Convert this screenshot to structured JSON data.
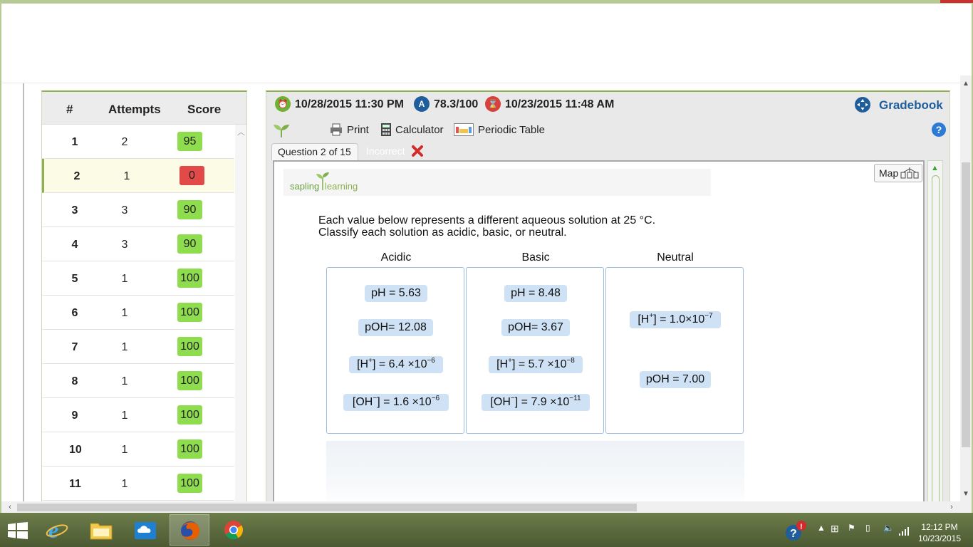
{
  "status": {
    "due_date": "10/28/2015 11:30 PM",
    "grade": "78.3/100",
    "last_date": "10/23/2015 11:48 AM",
    "gradebook_label": "Gradebook"
  },
  "toolbar": {
    "print_label": "Print",
    "calculator_label": "Calculator",
    "periodic_table_label": "Periodic Table"
  },
  "tabs": {
    "question_label": "Question 2 of 15",
    "status_label": "Incorrect"
  },
  "score_table": {
    "headers": [
      "#",
      "Attempts",
      "Score"
    ],
    "rows": [
      {
        "num": "1",
        "attempts": "2",
        "score": "95",
        "status": "green"
      },
      {
        "num": "2",
        "attempts": "1",
        "score": "0",
        "status": "red"
      },
      {
        "num": "3",
        "attempts": "3",
        "score": "90",
        "status": "green"
      },
      {
        "num": "4",
        "attempts": "3",
        "score": "90",
        "status": "green"
      },
      {
        "num": "5",
        "attempts": "1",
        "score": "100",
        "status": "green"
      },
      {
        "num": "6",
        "attempts": "1",
        "score": "100",
        "status": "green"
      },
      {
        "num": "7",
        "attempts": "1",
        "score": "100",
        "status": "green"
      },
      {
        "num": "8",
        "attempts": "1",
        "score": "100",
        "status": "green"
      },
      {
        "num": "9",
        "attempts": "1",
        "score": "100",
        "status": "green"
      },
      {
        "num": "10",
        "attempts": "1",
        "score": "100",
        "status": "green"
      },
      {
        "num": "11",
        "attempts": "1",
        "score": "100",
        "status": "green"
      }
    ]
  },
  "question": {
    "brand_text_1": "sapling",
    "brand_text_2": "learning",
    "map_label": "Map",
    "prompt_line1": "Each value below represents a different aqueous solution at 25 °C.",
    "prompt_line2": "Classify each solution as acidic, basic, or neutral.",
    "columns": {
      "acidic": "Acidic",
      "basic": "Basic",
      "neutral": "Neutral"
    },
    "acidic_items": {
      "ph": "pH = 5.63",
      "poh": "pOH= 12.08",
      "h_base": "[H",
      "h_charge": "+",
      "h_value": "] = 6.4 ×10",
      "h_exp": "−6",
      "oh_base": "[OH",
      "oh_charge": "−",
      "oh_value": "] = 1.6 ×10",
      "oh_exp": "−6"
    },
    "basic_items": {
      "ph": "pH = 8.48",
      "poh": "pOH= 3.67",
      "h_base": "[H",
      "h_charge": "+",
      "h_value": "] = 5.7 ×10",
      "h_exp": "−8",
      "oh_base": "[OH",
      "oh_charge": "−",
      "oh_value": "] = 7.9 ×10",
      "oh_exp": "−11"
    },
    "neutral_items": {
      "h_base": "[H",
      "h_charge": "+",
      "h_value": "] = 1.0×10",
      "h_exp": "−7",
      "poh": "pOH = 7.00"
    }
  },
  "taskbar": {
    "time": "12:12 PM",
    "date": "10/23/2015"
  },
  "colors": {
    "accent": "#8fb04f",
    "link": "#1f5e9a",
    "score_green": "#8fdc4e",
    "score_red": "#e24a4a",
    "chip": "#cfe2f5"
  }
}
